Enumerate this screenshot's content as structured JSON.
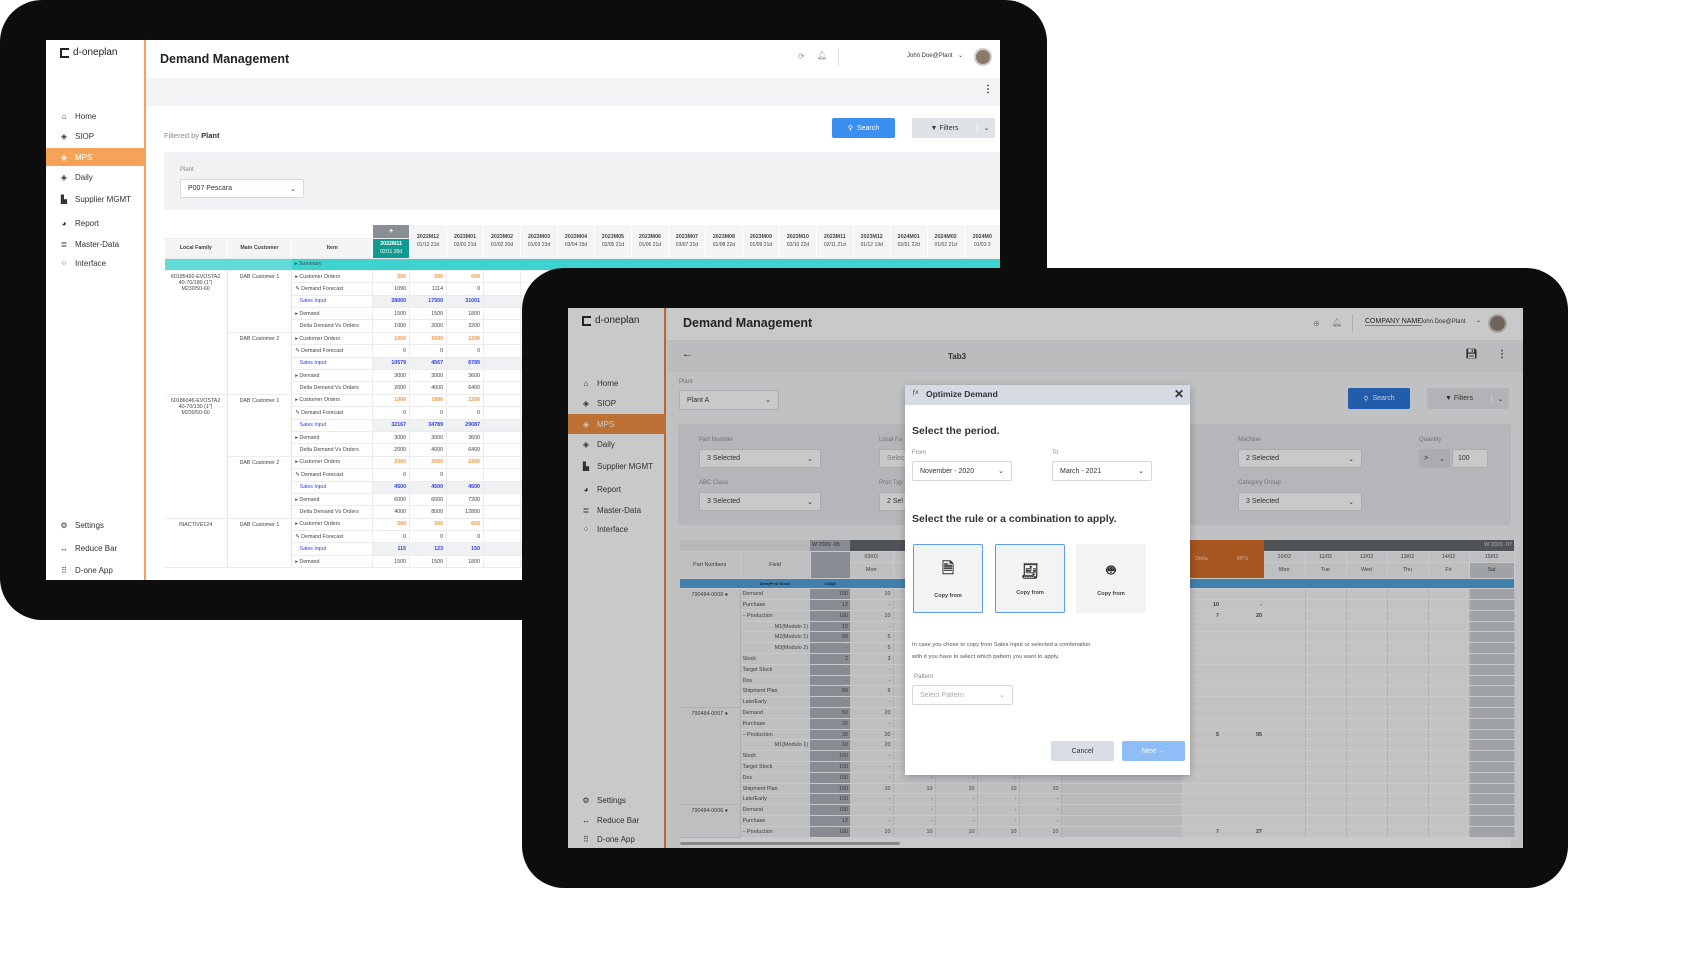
{
  "colors": {
    "accent_orange": "#f6a35a",
    "primary_blue": "#3b8ff0",
    "teal": "#3dd4d0",
    "teal_dark": "#129a90",
    "sales_input_blue": "#2d3fe0",
    "orders_orange": "#f59540",
    "mps_orange": "#d0661c",
    "row_blue": "#4a9ed9"
  },
  "tablet1": {
    "logo": "d-oneplan",
    "title": "Demand Management",
    "user": "John Doe@Plant",
    "sidebar": {
      "items": [
        {
          "label": "Home",
          "icon": "home-icon"
        },
        {
          "label": "SIOP",
          "icon": "layers-icon"
        },
        {
          "label": "MPS",
          "icon": "layers-icon",
          "active": true
        },
        {
          "label": "Daily",
          "icon": "layers-icon"
        },
        {
          "label": "Supplier MGMT",
          "icon": "factory-icon"
        },
        {
          "label": "Report",
          "icon": "pie-chart-icon"
        },
        {
          "label": "Master-Data",
          "icon": "database-icon"
        },
        {
          "label": "Interface",
          "icon": "network-icon"
        }
      ],
      "bottom": [
        {
          "label": "Settings",
          "icon": "gear-icon"
        },
        {
          "label": "Reduce Bar",
          "icon": "arrows-icon"
        },
        {
          "label": "D-one App",
          "icon": "grid-icon"
        }
      ]
    },
    "filtered_by_prefix": "Filtered by",
    "filtered_by_value": "Plant",
    "search_label": "Search",
    "filters_label": "Filters",
    "plant_label": "Plant",
    "plant_value": "P007 Pescara",
    "table": {
      "headers": [
        "Local Family",
        "Main Customer",
        "Item"
      ],
      "add_column": "+",
      "months": [
        {
          "m": "2022M11",
          "d": "02/11 20d"
        },
        {
          "m": "2022M12",
          "d": "01/12 21d"
        },
        {
          "m": "2023M01",
          "d": "02/01 21d"
        },
        {
          "m": "2023M02",
          "d": "01/02 20d"
        },
        {
          "m": "2023M03",
          "d": "01/03 23d"
        },
        {
          "m": "2023M04",
          "d": "03/04 15d"
        },
        {
          "m": "2023M05",
          "d": "02/05 21d"
        },
        {
          "m": "2023M06",
          "d": "01/06 21d"
        },
        {
          "m": "2023M07",
          "d": "03/07 21d"
        },
        {
          "m": "2023M08",
          "d": "01/08 22d"
        },
        {
          "m": "2023M09",
          "d": "01/09 21d"
        },
        {
          "m": "2023M10",
          "d": "02/10 22d"
        },
        {
          "m": "2023M11",
          "d": "02/11 21d"
        },
        {
          "m": "2023M12",
          "d": "01/12 19d"
        },
        {
          "m": "2024M01",
          "d": "02/01 22d"
        },
        {
          "m": "2024M02",
          "d": "01/02 21d"
        },
        {
          "m": "2024M0",
          "d": "01/03 2"
        }
      ],
      "summary": "Summary",
      "groups": [
        {
          "family": "60185492-EVOSTA2 40-70/180 (1\") M230/50-60",
          "customers": [
            {
              "name": "DAB Customer 1",
              "rows": [
                {
                  "item": "Customer Orders",
                  "kind": "orders",
                  "values": [
                    "500",
                    "500",
                    "600"
                  ]
                },
                {
                  "item": "Demand Forecast",
                  "kind": "forecast",
                  "values": [
                    "1090",
                    "1114",
                    "0"
                  ]
                },
                {
                  "item": "Sales Input",
                  "kind": "sales",
                  "values": [
                    "28000",
                    "17500",
                    "31001"
                  ]
                },
                {
                  "item": "Demand",
                  "kind": "demand",
                  "values": [
                    "1500",
                    "1500",
                    "1800"
                  ]
                },
                {
                  "item": "Delta Demand Vs Orders",
                  "kind": "delta",
                  "values": [
                    "1000",
                    "2000",
                    "3200"
                  ]
                }
              ]
            },
            {
              "name": "DAB Customer 2",
              "rows": [
                {
                  "item": "Customer Orders",
                  "kind": "orders",
                  "values": [
                    "1000",
                    "1000",
                    "1200"
                  ]
                },
                {
                  "item": "Demand Forecast",
                  "kind": "forecast",
                  "values": [
                    "0",
                    "0",
                    "0"
                  ]
                },
                {
                  "item": "Sales Input",
                  "kind": "sales",
                  "values": [
                    "10579",
                    "4567",
                    "6789"
                  ]
                },
                {
                  "item": "Demand",
                  "kind": "demand",
                  "values": [
                    "3000",
                    "3000",
                    "3600"
                  ]
                },
                {
                  "item": "Delta Demand Vs Orders",
                  "kind": "delta",
                  "values": [
                    "2000",
                    "4000",
                    "6400"
                  ]
                }
              ]
            }
          ]
        },
        {
          "family": "60186046-EVOSTA2 40-70/130 (1\") M230/50-60",
          "customers": [
            {
              "name": "DAB Customer 1",
              "rows": [
                {
                  "item": "Customer Orders",
                  "kind": "orders",
                  "values": [
                    "1000",
                    "1000",
                    "1200"
                  ]
                },
                {
                  "item": "Demand Forecast",
                  "kind": "forecast",
                  "values": [
                    "0",
                    "0",
                    "0"
                  ]
                },
                {
                  "item": "Sales Input",
                  "kind": "sales",
                  "values": [
                    "32167",
                    "34789",
                    "29087"
                  ]
                },
                {
                  "item": "Demand",
                  "kind": "demand",
                  "values": [
                    "3000",
                    "3000",
                    "3600"
                  ]
                },
                {
                  "item": "Delta Demand Vs Orders",
                  "kind": "delta",
                  "values": [
                    "2000",
                    "4000",
                    "6400"
                  ]
                }
              ]
            },
            {
              "name": "DAB Customer 2",
              "rows": [
                {
                  "item": "Customer Orders",
                  "kind": "orders",
                  "values": [
                    "2000",
                    "2000",
                    "2400"
                  ]
                },
                {
                  "item": "Demand Forecast",
                  "kind": "forecast",
                  "values": [
                    "0",
                    "0",
                    ""
                  ]
                },
                {
                  "item": "Sales Input",
                  "kind": "sales",
                  "values": [
                    "4500",
                    "4500",
                    "4500"
                  ]
                },
                {
                  "item": "Demand",
                  "kind": "demand",
                  "values": [
                    "6000",
                    "6000",
                    "7200"
                  ]
                },
                {
                  "item": "Delta Demand Vs Orders",
                  "kind": "delta",
                  "values": [
                    "4000",
                    "8000",
                    "12800"
                  ]
                }
              ]
            }
          ]
        },
        {
          "family": "INACTIVE124",
          "customers": [
            {
              "name": "DAB Customer 1",
              "rows": [
                {
                  "item": "Customer Orders",
                  "kind": "orders",
                  "values": [
                    "500",
                    "500",
                    "600"
                  ]
                },
                {
                  "item": "Demand Forecast",
                  "kind": "forecast",
                  "values": [
                    "0",
                    "0",
                    "0"
                  ]
                },
                {
                  "item": "Sales Input",
                  "kind": "sales",
                  "values": [
                    "115",
                    "123",
                    "150"
                  ]
                },
                {
                  "item": "Demand",
                  "kind": "demand",
                  "values": [
                    "1500",
                    "1500",
                    "1800"
                  ]
                }
              ]
            }
          ]
        }
      ]
    }
  },
  "tablet2": {
    "logo": "d-oneplan",
    "title": "Demand Management",
    "company": "COMPANY NAME",
    "user": "John Doe@Plant",
    "tab": "Tab3",
    "sidebar": {
      "items": [
        {
          "label": "Home"
        },
        {
          "label": "SIOP"
        },
        {
          "label": "MPS",
          "active": true
        },
        {
          "label": "Daily"
        },
        {
          "label": "Supplier MGMT"
        },
        {
          "label": "Report"
        },
        {
          "label": "Master-Data"
        },
        {
          "label": "Interface"
        }
      ],
      "bottom": [
        {
          "label": "Settings"
        },
        {
          "label": "Reduce Bar"
        },
        {
          "label": "D-one App"
        }
      ]
    },
    "plant_label": "Plant",
    "plant_value": "Plant A",
    "search_label": "Search",
    "filters_label": "Filters",
    "filters": {
      "part_number": {
        "label": "Part Number",
        "value": "3 Selected"
      },
      "local_family": {
        "label": "Local Fa",
        "value": "Selec"
      },
      "abc_class": {
        "label": "ABC Class",
        "value": "3 Selected"
      },
      "proc_type": {
        "label": "Proc Typ",
        "value": "2 Sel"
      },
      "machine": {
        "label": "Machine",
        "value": "2 Selected"
      },
      "category_group": {
        "label": "Category Group",
        "value": "3 Selected"
      },
      "quantity": {
        "label": "Quantity",
        "operator": ">",
        "value": "100"
      }
    },
    "grid": {
      "headers": {
        "part": "Part Numbers",
        "field": "Field",
        "week_left": "W 2020 -05",
        "week_right": "W 2020 -07",
        "date_mon": "03/02",
        "day_mon": "Mon",
        "delta": "Delta",
        "mps": "MPS",
        "right_days": [
          {
            "date": "10/02",
            "day": "Mon"
          },
          {
            "date": "11/02",
            "day": "Tue"
          },
          {
            "date": "12/02",
            "day": "Wed"
          },
          {
            "date": "13/02",
            "day": "Thu"
          },
          {
            "date": "14/02",
            "day": "Fri"
          },
          {
            "date": "15/02",
            "day": "Sat"
          }
        ]
      },
      "band": {
        "field": "Dem|Pred Stock",
        "week": "10|3|8"
      },
      "rows": [
        {
          "part": "790484-0008",
          "field": "Demand",
          "indent": 0,
          "v": [
            "100",
            "10",
            "",
            "",
            "",
            "",
            "",
            ""
          ]
        },
        {
          "field": "Purchase",
          "indent": 0,
          "v": [
            "12",
            "-",
            "",
            "",
            "",
            "",
            "10",
            "-"
          ]
        },
        {
          "field": "– Production",
          "indent": 0,
          "v": [
            "100",
            "10",
            "",
            "",
            "",
            "",
            "7",
            "20"
          ],
          "red_delta": true
        },
        {
          "field": "M1(Modulo 1)",
          "indent": 1,
          "v": [
            "10",
            "-",
            "",
            "",
            "",
            "",
            "",
            ""
          ]
        },
        {
          "field": "M2(Modulo 1)",
          "indent": 1,
          "v": [
            "90",
            "5",
            "",
            "",
            "",
            "",
            "",
            ""
          ]
        },
        {
          "field": "M3(Modulo 2)",
          "indent": 1,
          "v": [
            "-",
            "5",
            "",
            "",
            "",
            "",
            "",
            ""
          ]
        },
        {
          "field": "Stock",
          "indent": 0,
          "v": [
            "2",
            "3",
            "",
            "",
            "",
            "",
            "",
            ""
          ]
        },
        {
          "field": "Target Stock",
          "indent": 0,
          "v": [
            "-",
            "-",
            "",
            "",
            "",
            "",
            "",
            ""
          ]
        },
        {
          "field": "Dos",
          "indent": 0,
          "v": [
            "-",
            "-",
            "",
            "",
            "",
            "",
            "",
            ""
          ]
        },
        {
          "field": "Shipment Plan",
          "indent": 0,
          "v": [
            "89",
            "9",
            "",
            "",
            "",
            "",
            "",
            ""
          ]
        },
        {
          "field": "Late/Early",
          "indent": 0,
          "v": [
            "-",
            "-",
            "",
            "",
            "",
            "",
            "",
            ""
          ]
        },
        {
          "part": "790484-0007",
          "field": "Demand",
          "indent": 0,
          "v": [
            "50",
            "20",
            "",
            "",
            "",
            "",
            "",
            ""
          ]
        },
        {
          "field": "Purchase",
          "indent": 0,
          "v": [
            "20",
            "-",
            "",
            "",
            "",
            "",
            "",
            ""
          ]
        },
        {
          "field": "– Production",
          "indent": 0,
          "v": [
            "30",
            "20",
            "",
            "",
            "",
            "",
            "5",
            "95"
          ]
        },
        {
          "field": "M1(Modulo 1)",
          "indent": 1,
          "v": [
            "10",
            "20",
            "",
            "",
            "",
            "",
            "",
            ""
          ]
        },
        {
          "field": "Stock",
          "indent": 0,
          "v": [
            "100",
            "-",
            "",
            "",
            "",
            "",
            "",
            ""
          ]
        },
        {
          "field": "Target Stock",
          "indent": 0,
          "v": [
            "100",
            "-",
            "",
            "",
            "",
            "",
            "",
            ""
          ]
        },
        {
          "field": "Dos",
          "indent": 0,
          "v": [
            "100",
            "-",
            "-",
            "-",
            "-",
            "",
            "",
            ""
          ]
        },
        {
          "field": "Shipment Plan",
          "indent": 0,
          "v": [
            "100",
            "10",
            "10",
            "10",
            "10",
            "10",
            "",
            ""
          ]
        },
        {
          "field": "Late/Early",
          "indent": 0,
          "v": [
            "100",
            "-",
            "-",
            "-",
            "-",
            "-",
            "",
            ""
          ]
        },
        {
          "part": "790484-0006",
          "field": "Demand",
          "indent": 0,
          "v": [
            "100",
            "-",
            "-",
            "-",
            "-",
            "-",
            "",
            ""
          ]
        },
        {
          "field": "Purchase",
          "indent": 0,
          "v": [
            "12",
            "-",
            "-",
            "-",
            "-",
            "-",
            "",
            ""
          ]
        },
        {
          "field": "– Production",
          "indent": 0,
          "v": [
            "100",
            "10",
            "10",
            "10",
            "10",
            "10",
            "7",
            "27"
          ],
          "red_delta": true
        }
      ]
    },
    "modal": {
      "title": "Optimize Demand",
      "period_heading": "Select the period.",
      "from_label": "From",
      "from_value": "November - 2020",
      "to_label": "To",
      "to_value": "March - 2021",
      "rule_heading": "Select the rule or a combination to apply.",
      "cards": [
        {
          "label": "Copy from",
          "icon": "dollar-document-icon",
          "selected": true
        },
        {
          "label": "Copy from",
          "icon": "percent-receipt-icon",
          "selected": true
        },
        {
          "label": "Copy from",
          "icon": "robot-icon",
          "selected": false
        }
      ],
      "help_line1": "In case you chose to copy from Sales Input or selected a combination",
      "help_line2": "with it you have to select which pattern you want to apply.",
      "pattern_label": "Pattern",
      "pattern_placeholder": "Select Pattern",
      "cancel_label": "Cancel",
      "next_label": "Next →"
    }
  }
}
